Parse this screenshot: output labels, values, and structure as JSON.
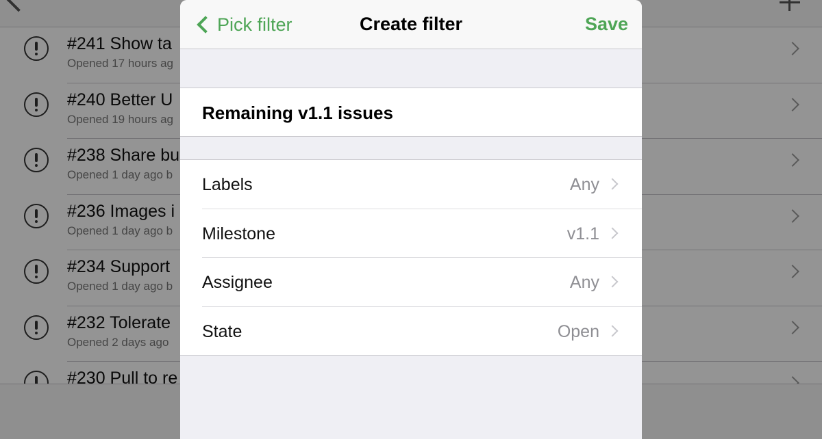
{
  "background": {
    "issues": [
      {
        "title": "#241 Show ta",
        "subtitle": "Opened 17 hours ag"
      },
      {
        "title": "#240 Better U",
        "subtitle": "Opened 19 hours ag"
      },
      {
        "title": "#238 Share bu",
        "subtitle": "Opened 1 day ago b"
      },
      {
        "title": "#236 Images i",
        "subtitle": "Opened 1 day ago b"
      },
      {
        "title": "#234 Support",
        "subtitle": "Opened 1 day ago b"
      },
      {
        "title": "#232 Tolerate",
        "subtitle": "Opened 2 days ago"
      },
      {
        "title": "#230 Pull to re",
        "subtitle": ""
      }
    ]
  },
  "modal": {
    "nav": {
      "back_label": "Pick filter",
      "title": "Create filter",
      "save_label": "Save"
    },
    "filter_name": "Remaining v1.1 issues",
    "options": [
      {
        "label": "Labels",
        "value": "Any"
      },
      {
        "label": "Milestone",
        "value": "v1.1"
      },
      {
        "label": "Assignee",
        "value": "Any"
      },
      {
        "label": "State",
        "value": "Open"
      }
    ]
  },
  "colors": {
    "accent": "#4ea556",
    "dim_overlay": "rgba(0,0,0,0.42)"
  },
  "icons": [
    "back-chevron-icon",
    "add-icon",
    "issue-open-icon",
    "chevron-right-icon"
  ]
}
